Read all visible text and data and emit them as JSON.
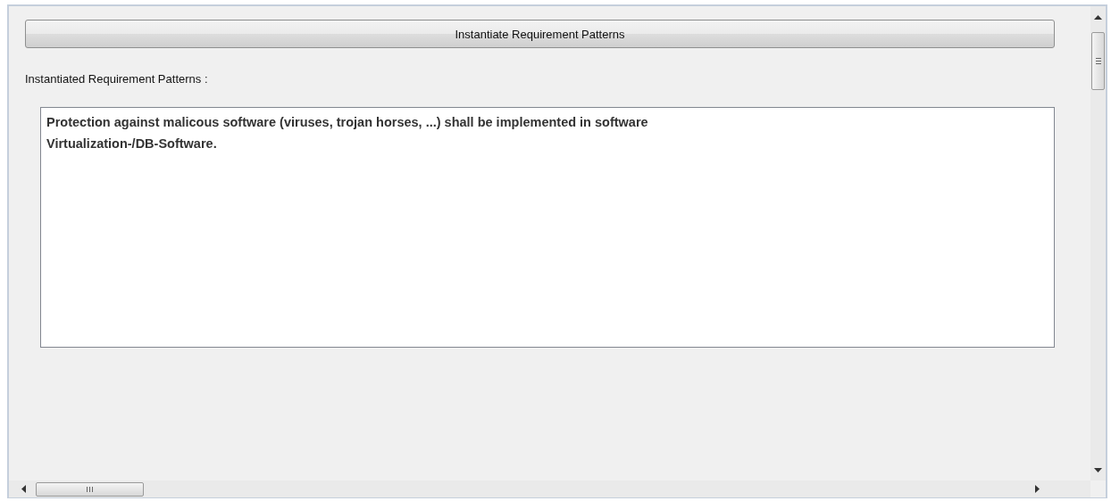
{
  "instantiate_button": {
    "label": "Instantiate Requirement Patterns"
  },
  "result_label": "Instantiated Requirement Patterns :",
  "result_text": {
    "lines": [
      "Protection against malicous software (viruses, trojan horses, ...) shall be implemented in software",
      "Virtualization-/DB-Software."
    ]
  }
}
